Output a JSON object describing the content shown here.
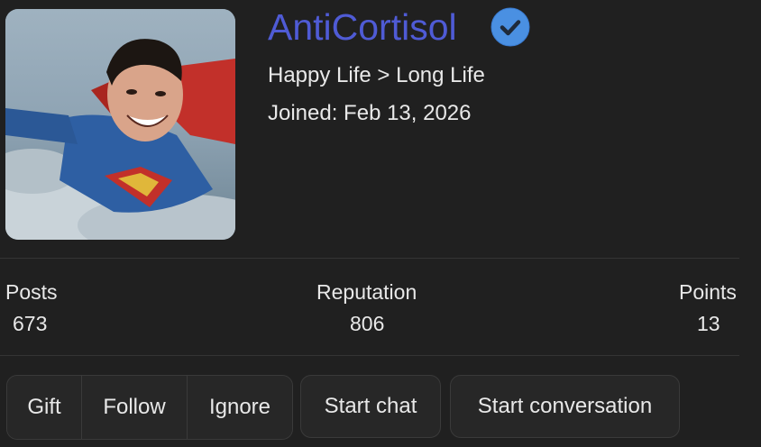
{
  "profile": {
    "username": "AntiCortisol",
    "tagline": "Happy Life > Long Life",
    "joined": "Joined: Feb 13, 2026",
    "verified_color": "#4a90e2",
    "username_color": "#4f5bd5"
  },
  "stats": {
    "posts": {
      "label": "Posts",
      "value": "673"
    },
    "reputation": {
      "label": "Reputation",
      "value": "806"
    },
    "points": {
      "label": "Points",
      "value": "13"
    }
  },
  "actions": {
    "gift": "Gift",
    "follow": "Follow",
    "ignore": "Ignore",
    "start_chat": "Start chat",
    "start_conversation": "Start conversation"
  }
}
